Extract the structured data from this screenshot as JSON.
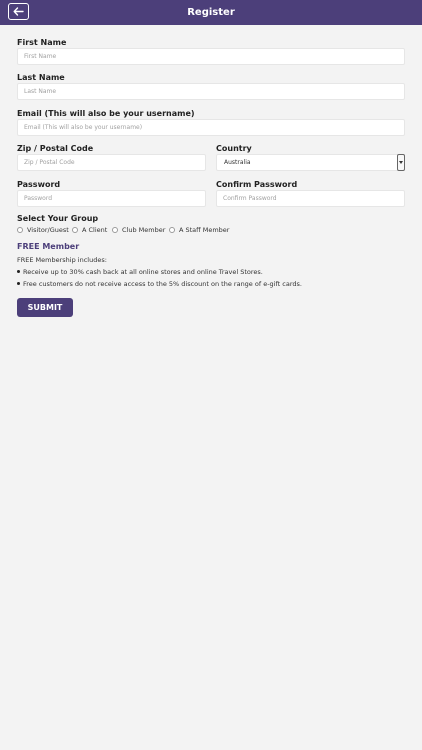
{
  "header": {
    "title": "Register",
    "back_icon": "arrow-left-icon",
    "color": "#4c3f7a"
  },
  "form": {
    "first_name": {
      "label": "First Name",
      "placeholder": "First Name"
    },
    "last_name": {
      "label": "Last Name",
      "placeholder": "Last Name"
    },
    "email": {
      "label": "Email (This will also be your username)",
      "placeholder": "Email (This will also be your username)"
    },
    "zip": {
      "label": "Zip / Postal Code",
      "placeholder": "Zip / Postal Code"
    },
    "country": {
      "label": "Country",
      "value": "Australia"
    },
    "password": {
      "label": "Password",
      "placeholder": "Password"
    },
    "confirm_password": {
      "label": "Confirm Password",
      "placeholder": "Confirm Password"
    },
    "group": {
      "label": "Select Your Group",
      "options": [
        "Visitor/Guest",
        "A Client",
        "Club Member",
        "A Staff Member"
      ]
    }
  },
  "membership": {
    "title": "FREE Member",
    "intro": "FREE Membership includes:",
    "bullets": [
      "Receive up to 30% cash back at all online stores and online Travel Stores.",
      "Free customers do not receive access to the 5% discount on the range of e-gift cards."
    ]
  },
  "submit_label": "SUBMIT"
}
